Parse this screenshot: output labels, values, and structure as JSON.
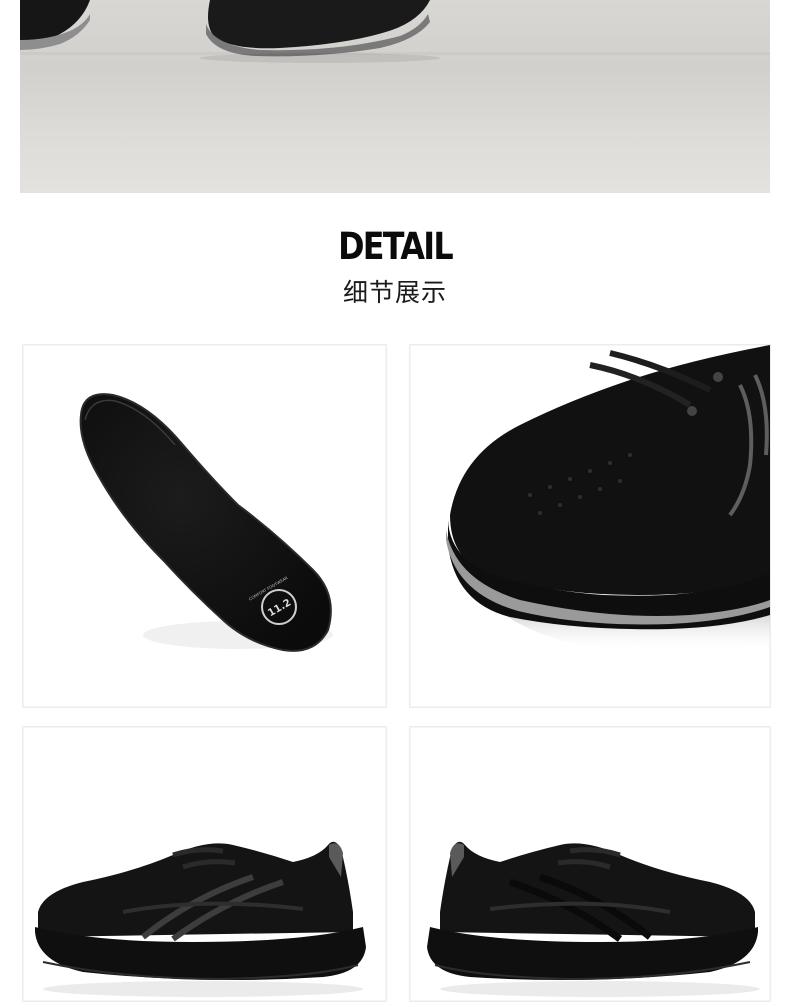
{
  "detail_section": {
    "title": "DETAIL",
    "subtitle": "细节展示"
  },
  "insole_badge": {
    "ring_text": "COMFORT FOOTWEAR",
    "number": "11.2"
  },
  "colors": {
    "shoe_black": "#121212",
    "outsole_grey": "#9a9a9a",
    "floor": "#d4d2ce"
  }
}
